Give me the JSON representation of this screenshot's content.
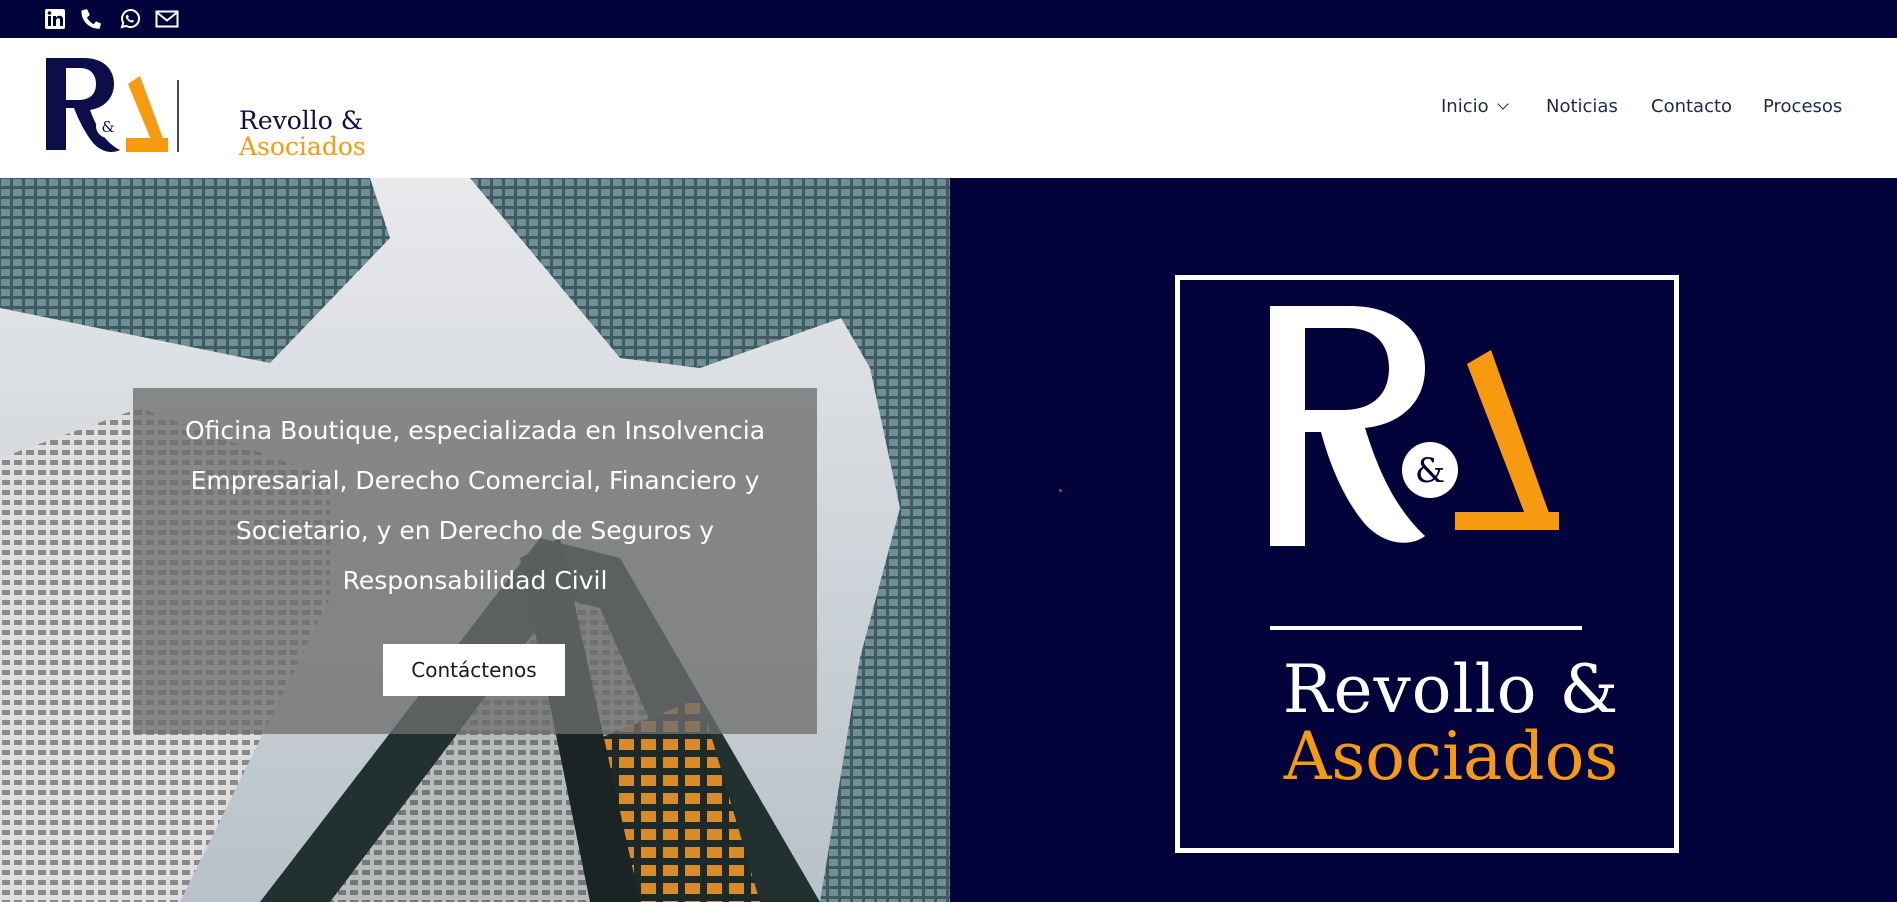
{
  "topbar": {
    "icons": [
      "linkedin-icon",
      "phone-icon",
      "whatsapp-icon",
      "mail-icon"
    ],
    "background": "#03033c"
  },
  "header": {
    "logo": {
      "mark": "R&A",
      "line1": "Revollo &",
      "line2": "Asociados"
    },
    "nav": [
      {
        "label": "Inicio",
        "has_dropdown": true
      },
      {
        "label": "Noticias"
      },
      {
        "label": "Contacto"
      },
      {
        "label": "Procesos"
      }
    ]
  },
  "hero": {
    "text": "Oficina Boutique, especializada en Insolvencia Empresarial, Derecho Comercial, Financiero y Societario, y en Derecho de Seguros y Responsabilidad Civil",
    "cta_label": "Contáctenos",
    "brand": {
      "ampersand": "&",
      "line1": "Revollo &",
      "line2": "Asociados"
    }
  },
  "colors": {
    "navy": "#03033c",
    "orange": "#f79a0f",
    "white": "#ffffff"
  }
}
